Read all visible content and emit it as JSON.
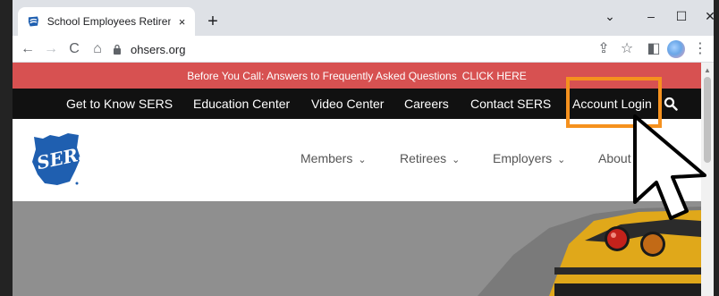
{
  "browser": {
    "tab_title": "School Employees Retirement Sy",
    "tab_close": "×",
    "new_tab": "+",
    "window_chevron": "⌄",
    "window_minimize": "–",
    "window_maximize": "☐",
    "window_close": "✕",
    "back": "←",
    "forward": "→",
    "reload": "C",
    "home": "⌂",
    "url": "ohsers.org",
    "share": "⇪",
    "star": "☆",
    "panel": "◧",
    "menu": "⋮"
  },
  "alert": {
    "text": "Before You Call: Answers to Frequently Asked Questions",
    "link": "CLICK HERE"
  },
  "topnav": {
    "items": [
      "Get to Know SERS",
      "Education Center",
      "Video Center",
      "Careers",
      "Contact SERS",
      "Account Login"
    ]
  },
  "mainnav": {
    "items": [
      "Members",
      "Retirees",
      "Employers",
      "About S"
    ],
    "caret": "⌄"
  },
  "colors": {
    "alert_bg": "#d75151",
    "topnav_bg": "#111111",
    "highlight": "#f5911e",
    "logo_blue": "#1f5fb0",
    "hero_gray": "#8f8f8f"
  },
  "icons": {
    "search": "search-icon",
    "lock": "lock-icon",
    "logo": "sers-logo",
    "cursor": "arrow-cursor-icon"
  }
}
